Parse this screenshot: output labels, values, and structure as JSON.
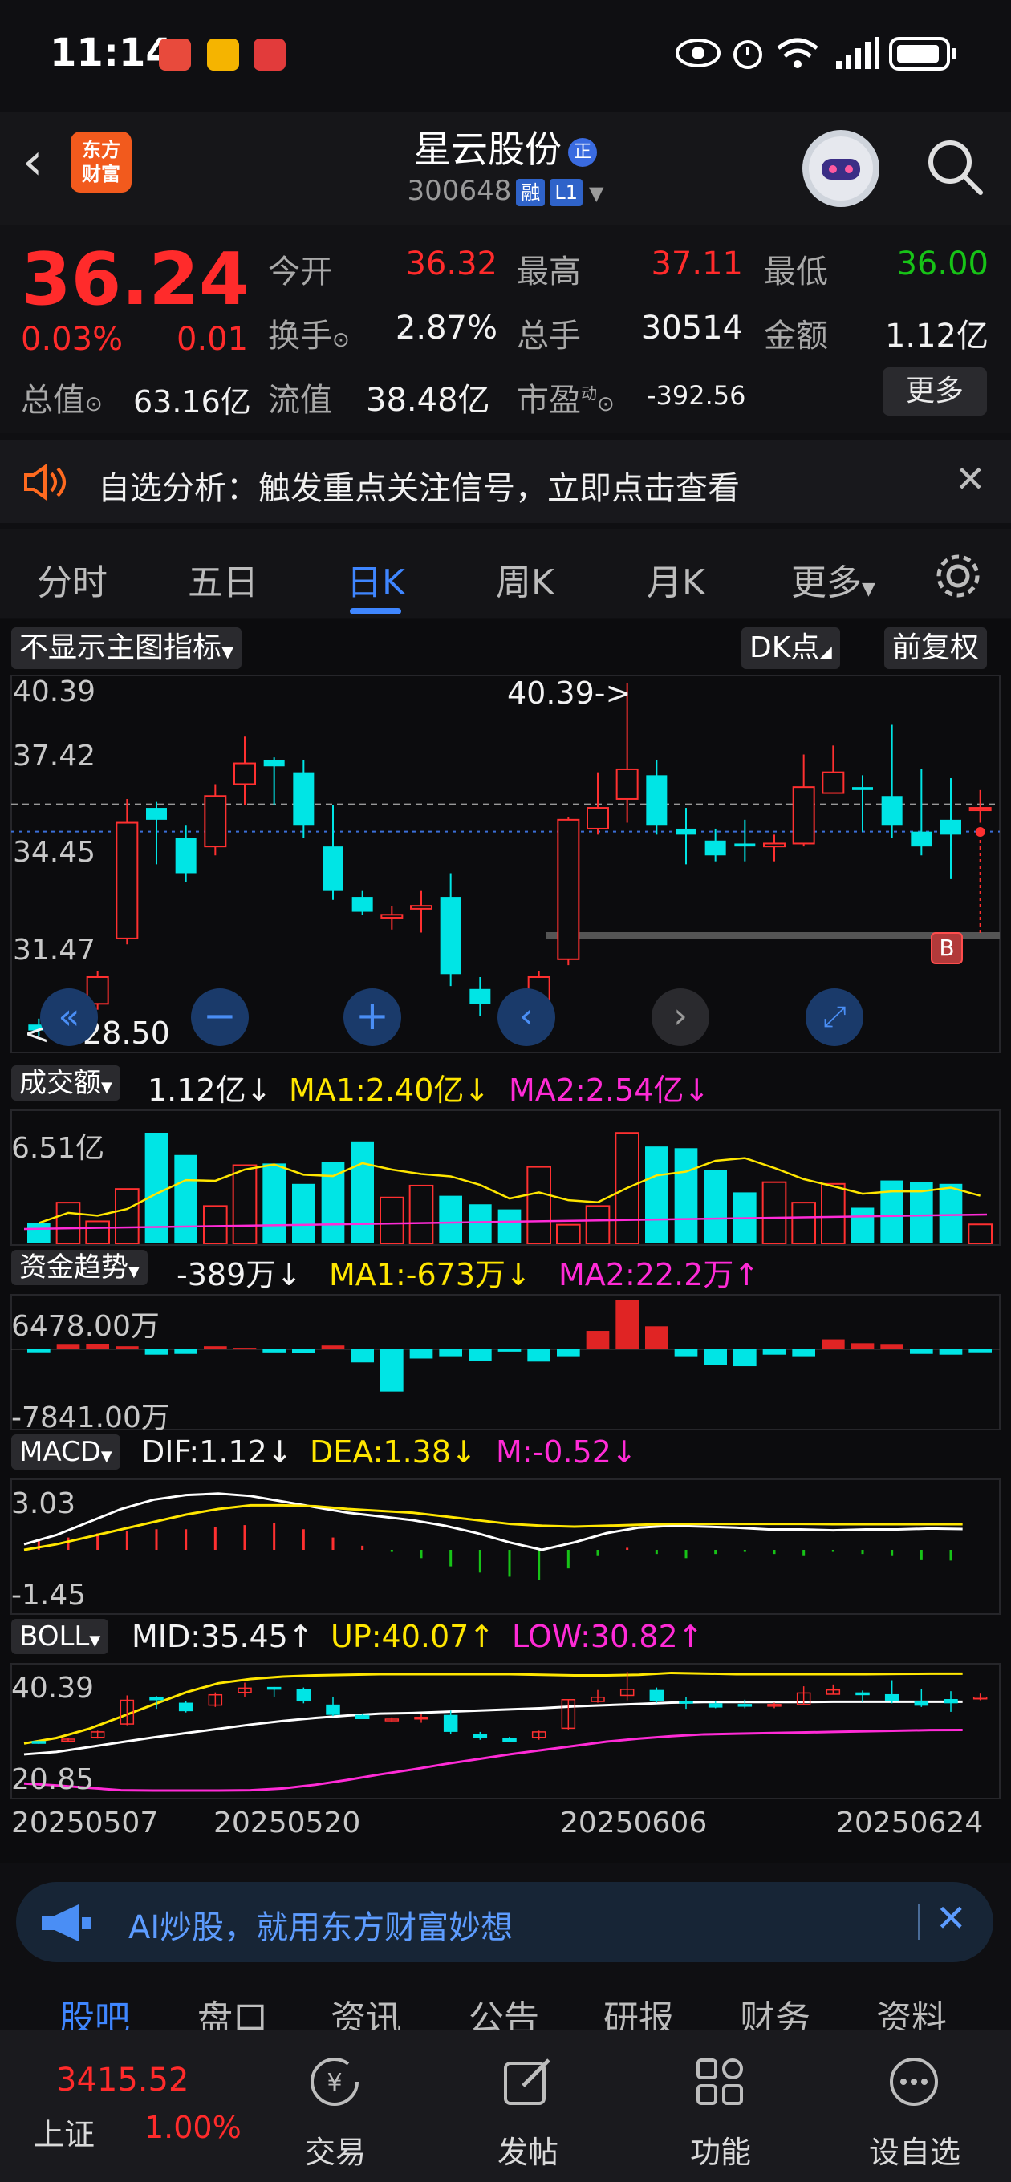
{
  "status_bar": {
    "time": "11:14"
  },
  "header": {
    "logo_line1": "东方",
    "logo_line2": "财富",
    "stock_name": "星云股份",
    "name_badge": "正",
    "stock_code": "300648",
    "tag_margin": "融",
    "tag_level": "L1"
  },
  "quote": {
    "price": "36.24",
    "change_pct": "0.03%",
    "change_abs": "0.01",
    "open_label": "今开",
    "open": "36.32",
    "high_label": "最高",
    "high": "37.11",
    "low_label": "最低",
    "low": "36.00",
    "turnover_label": "换手",
    "turnover": "2.87%",
    "volume_label": "总手",
    "volume": "30514",
    "amount_label": "金额",
    "amount": "1.12亿",
    "mktcap_label": "总值",
    "mktcap": "63.16亿",
    "float_label": "流值",
    "float": "38.48亿",
    "pe_label": "市盈",
    "pe_sup": "动",
    "pe": "-392.56",
    "more": "更多"
  },
  "notice": {
    "text": "自选分析：触发重点关注信号，立即点击查看"
  },
  "tabs": [
    "分时",
    "五日",
    "日K",
    "周K",
    "月K",
    "更多"
  ],
  "chart_toolbar": {
    "indicator_select": "不显示主图指标",
    "dk_button": "DK点",
    "adjust_button": "前复权"
  },
  "main_chart": {
    "y_labels": [
      "40.39",
      "37.42",
      "34.45",
      "31.47",
      "28.50"
    ],
    "high_marker": "40.39->",
    "low_marker": "<---28.50",
    "b_marker": "B"
  },
  "volume_panel": {
    "name": "成交额",
    "value": "1.12亿↓",
    "ma1": "MA1:2.40亿↓",
    "ma2": "MA2:2.54亿↓",
    "y_top": "6.51亿"
  },
  "fund_panel": {
    "name": "资金趋势",
    "value": "-389万↓",
    "ma1": "MA1:-673万↓",
    "ma2": "MA2:22.2万↑",
    "y_top": "6478.00万",
    "y_bottom": "-7841.00万"
  },
  "macd_panel": {
    "name": "MACD",
    "dif": "DIF:1.12↓",
    "dea": "DEA:1.38↓",
    "m": "M:-0.52↓",
    "y_top": "3.03",
    "y_bottom": "-1.45"
  },
  "boll_panel": {
    "name": "BOLL",
    "mid": "MID:35.45↑",
    "up": "UP:40.07↑",
    "low": "LOW:30.82↑",
    "y_top": "40.39",
    "y_bottom": "20.85"
  },
  "x_dates": [
    "20250507",
    "20250520",
    "20250606",
    "20250624"
  ],
  "ai_banner": {
    "text": "AI炒股，就用东方财富妙想"
  },
  "sub_tabs": [
    "股吧",
    "盘口",
    "资讯",
    "公告",
    "研报",
    "财务",
    "资料"
  ],
  "bottom_nav": {
    "index_value": "3415.52",
    "index_name": "上证",
    "index_change": "1.00%",
    "items": [
      "交易",
      "发帖",
      "功能",
      "设自选"
    ]
  },
  "chart_data": {
    "type": "candlestick",
    "title": "",
    "ylim": [
      28.5,
      40.39
    ],
    "candles": [
      {
        "o": 28.9,
        "c": 28.7,
        "h": 29.1,
        "l": 28.5
      },
      {
        "o": 29.0,
        "c": 29.3,
        "h": 29.5,
        "l": 28.8
      },
      {
        "o": 29.6,
        "c": 30.5,
        "h": 30.7,
        "l": 29.4
      },
      {
        "o": 31.8,
        "c": 35.7,
        "h": 36.5,
        "l": 31.6
      },
      {
        "o": 36.2,
        "c": 35.8,
        "h": 36.4,
        "l": 34.3
      },
      {
        "o": 35.2,
        "c": 34.0,
        "h": 35.6,
        "l": 33.7
      },
      {
        "o": 34.9,
        "c": 36.6,
        "h": 37.0,
        "l": 34.6
      },
      {
        "o": 37.0,
        "c": 37.7,
        "h": 38.6,
        "l": 36.3
      },
      {
        "o": 37.8,
        "c": 37.6,
        "h": 37.9,
        "l": 36.3
      },
      {
        "o": 37.4,
        "c": 35.6,
        "h": 37.8,
        "l": 35.2
      },
      {
        "o": 34.9,
        "c": 33.4,
        "h": 36.3,
        "l": 33.1
      },
      {
        "o": 33.2,
        "c": 32.7,
        "h": 33.4,
        "l": 32.6
      },
      {
        "o": 32.5,
        "c": 32.6,
        "h": 32.9,
        "l": 32.1
      },
      {
        "o": 32.8,
        "c": 32.9,
        "h": 33.4,
        "l": 32.0
      },
      {
        "o": 33.2,
        "c": 30.6,
        "h": 34.0,
        "l": 30.2
      },
      {
        "o": 30.1,
        "c": 29.6,
        "h": 30.5,
        "l": 29.2
      },
      {
        "o": 29.4,
        "c": 29.0,
        "h": 29.7,
        "l": 28.9
      },
      {
        "o": 29.6,
        "c": 30.5,
        "h": 30.7,
        "l": 29.2
      },
      {
        "o": 31.1,
        "c": 35.8,
        "h": 35.9,
        "l": 30.9
      },
      {
        "o": 35.5,
        "c": 36.2,
        "h": 37.4,
        "l": 35.3
      },
      {
        "o": 36.5,
        "c": 37.5,
        "h": 40.39,
        "l": 35.7
      },
      {
        "o": 37.3,
        "c": 35.6,
        "h": 37.8,
        "l": 35.3
      },
      {
        "o": 35.5,
        "c": 35.3,
        "h": 36.2,
        "l": 34.3
      },
      {
        "o": 35.1,
        "c": 34.6,
        "h": 35.5,
        "l": 34.4
      },
      {
        "o": 35.0,
        "c": 34.9,
        "h": 35.8,
        "l": 34.4
      },
      {
        "o": 34.9,
        "c": 35.0,
        "h": 35.3,
        "l": 34.4
      },
      {
        "o": 35.0,
        "c": 36.9,
        "h": 38.0,
        "l": 34.9
      },
      {
        "o": 36.7,
        "c": 37.4,
        "h": 38.3,
        "l": 36.7
      },
      {
        "o": 36.9,
        "c": 36.8,
        "h": 37.3,
        "l": 35.4
      },
      {
        "o": 36.6,
        "c": 35.6,
        "h": 39.0,
        "l": 35.2
      },
      {
        "o": 35.4,
        "c": 34.9,
        "h": 37.5,
        "l": 34.6
      },
      {
        "o": 35.8,
        "c": 35.3,
        "h": 37.2,
        "l": 33.8
      },
      {
        "o": 36.2,
        "c": 36.2,
        "h": 36.8,
        "l": 35.7
      }
    ],
    "volume": [
      1.2,
      2.4,
      1.3,
      3.2,
      6.51,
      5.2,
      2.2,
      4.6,
      4.7,
      3.5,
      4.8,
      6.0,
      2.7,
      3.4,
      2.8,
      2.3,
      2.0,
      4.5,
      1.1,
      2.2,
      6.5,
      5.7,
      5.6,
      4.3,
      3.0,
      3.6,
      2.4,
      3.5,
      2.1,
      3.7,
      3.6,
      3.5,
      1.12
    ],
    "fund_flow": [
      -389,
      600,
      700,
      400,
      -700,
      -600,
      400,
      200,
      -400,
      -500,
      500,
      -1700,
      -5500,
      -1200,
      -900,
      -1500,
      -300,
      -1600,
      -900,
      2400,
      6478,
      3000,
      -900,
      -2000,
      -2200,
      -700,
      -900,
      1300,
      800,
      600,
      -600,
      -700,
      -389
    ],
    "macd_hist": [
      0.5,
      0.6,
      0.8,
      0.9,
      1.0,
      1.0,
      1.1,
      1.2,
      1.3,
      1.0,
      0.6,
      0.2,
      -0.1,
      -0.4,
      -0.8,
      -1.1,
      -1.3,
      -1.45,
      -0.9,
      -0.3,
      0.1,
      -0.2,
      -0.4,
      -0.2,
      -0.1,
      -0.2,
      -0.3,
      -0.1,
      -0.2,
      -0.3,
      -0.5,
      -0.52
    ],
    "dif": [
      0.3,
      0.8,
      1.5,
      2.2,
      2.7,
      2.95,
      3.03,
      2.9,
      2.6,
      2.3,
      2.0,
      1.8,
      1.6,
      1.3,
      0.9,
      0.4,
      0.0,
      0.4,
      0.9,
      1.2,
      1.3,
      1.25,
      1.2,
      1.1,
      1.1,
      1.05,
      1.1,
      1.1,
      1.15,
      1.12
    ],
    "dea": [
      0.0,
      0.3,
      0.7,
      1.1,
      1.5,
      1.9,
      2.2,
      2.4,
      2.4,
      2.35,
      2.2,
      2.1,
      2.0,
      1.8,
      1.6,
      1.4,
      1.3,
      1.25,
      1.3,
      1.35,
      1.4,
      1.4,
      1.4,
      1.4,
      1.4,
      1.38,
      1.38,
      1.38,
      1.38,
      1.38
    ],
    "boll_up": [
      28.6,
      29.5,
      31,
      33,
      35,
      37,
      38.5,
      39.2,
      39.6,
      39.8,
      39.9,
      40.0,
      40.0,
      40.0,
      40.0,
      40.0,
      39.9,
      39.8,
      39.8,
      39.9,
      40.2,
      40.1,
      40.0,
      40.0,
      40.0,
      40.0,
      40.0,
      40.05,
      40.07,
      40.07
    ],
    "boll_mid": [
      26.8,
      27.2,
      28,
      28.8,
      29.6,
      30.3,
      31,
      31.7,
      32.3,
      32.8,
      33.2,
      33.5,
      33.6,
      33.8,
      34.0,
      34.2,
      34.4,
      34.7,
      34.9,
      35.1,
      35.3,
      35.4,
      35.4,
      35.4,
      35.4,
      35.45,
      35.45,
      35.45,
      35.45,
      35.45
    ],
    "boll_low": [
      22.0,
      21.7,
      21.3,
      20.9,
      20.85,
      20.85,
      20.85,
      20.9,
      21.2,
      21.8,
      22.6,
      23.5,
      24.3,
      25.2,
      26.0,
      26.8,
      27.5,
      28.2,
      28.9,
      29.4,
      29.8,
      30.1,
      30.2,
      30.3,
      30.4,
      30.5,
      30.6,
      30.7,
      30.8,
      30.82
    ]
  }
}
